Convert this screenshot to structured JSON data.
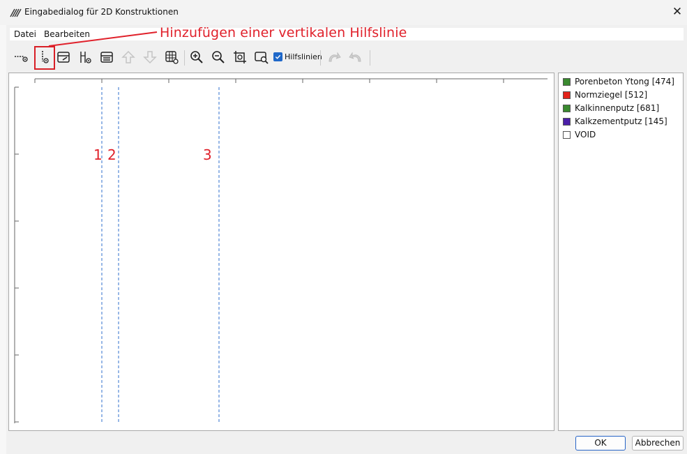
{
  "window": {
    "title": "Eingabedialog für 2D Konstruktionen",
    "close_glyph": "✕"
  },
  "menu": {
    "items": [
      "Datei",
      "Bearbeiten"
    ]
  },
  "annotation": {
    "text": "Hinzufügen einer vertikalen Hilfslinie",
    "color": "#e0212b"
  },
  "toolbar": {
    "buttons": [
      {
        "icon": "add-horizontal-guide-icon",
        "enabled": true
      },
      {
        "icon": "add-vertical-guide-icon",
        "enabled": true,
        "highlighted": true
      },
      {
        "icon": "edit-layer-icon",
        "enabled": true
      },
      {
        "icon": "add-layer-icon",
        "enabled": true
      },
      {
        "icon": "layer-list-icon",
        "enabled": true
      },
      {
        "icon": "move-up-icon",
        "enabled": false
      },
      {
        "icon": "move-down-icon",
        "enabled": false
      },
      {
        "icon": "grid-settings-icon",
        "enabled": true
      },
      {
        "icon": "zoom-in-icon",
        "enabled": true
      },
      {
        "icon": "zoom-out-icon",
        "enabled": true
      },
      {
        "icon": "zoom-fit-icon",
        "enabled": true
      },
      {
        "icon": "zoom-window-icon",
        "enabled": true
      },
      {
        "icon": "undo-icon",
        "enabled": false
      },
      {
        "icon": "redo-icon",
        "enabled": false
      }
    ],
    "guides_checkbox": {
      "label": "Hilfslinien",
      "checked": true
    }
  },
  "canvas": {
    "guide_labels": [
      "1",
      "2",
      "3"
    ],
    "guide_color": "#2f6fcc"
  },
  "legend": {
    "items": [
      {
        "label": "Porenbeton Ytong [474]",
        "color": "#3a8a2f"
      },
      {
        "label": "Normziegel [512]",
        "color": "#e2231a"
      },
      {
        "label": "Kalkinnenputz [681]",
        "color": "#3a8a2f"
      },
      {
        "label": "Kalkzementputz [145]",
        "color": "#4b1fa8"
      },
      {
        "label": "VOID",
        "color": "#ffffff"
      }
    ]
  },
  "buttons": {
    "ok": "OK",
    "cancel": "Abbrechen"
  }
}
